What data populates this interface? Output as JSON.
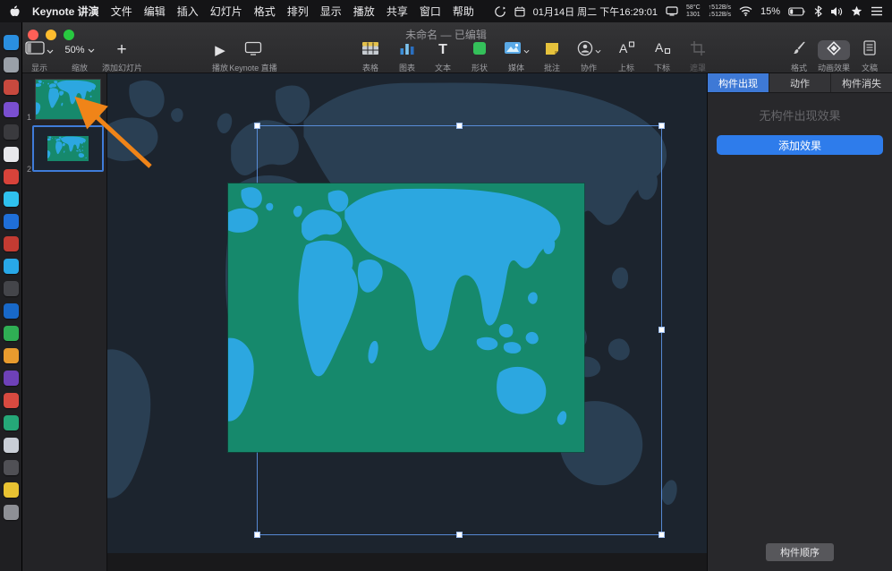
{
  "menu_bar": {
    "app_name": "Keynote 讲演",
    "menus": [
      "文件",
      "编辑",
      "插入",
      "幻灯片",
      "格式",
      "排列",
      "显示",
      "播放",
      "共享",
      "窗口",
      "帮助"
    ],
    "status": {
      "date_time": "01月14日 周二 下午16:29:01",
      "temp": "58°C",
      "temp_fan": "1301",
      "net_up": "↑512B/s",
      "net_down": "↓512B/s",
      "battery_pct": "15%"
    }
  },
  "window": {
    "title": "未命名 — 已编辑"
  },
  "toolbar": {
    "view": {
      "label": "显示"
    },
    "zoom": {
      "label": "缩放",
      "value": "50%"
    },
    "add_slide": {
      "label": "添加幻灯片"
    },
    "play": {
      "label": "播放"
    },
    "live": {
      "label": "Keynote 直播"
    },
    "insert_items": [
      {
        "label": "表格"
      },
      {
        "label": "图表"
      },
      {
        "label": "文本"
      },
      {
        "label": "形状"
      },
      {
        "label": "媒体"
      },
      {
        "label": "批注"
      },
      {
        "label": "协作"
      },
      {
        "label": "上标"
      },
      {
        "label": "下标"
      },
      {
        "label": "遮罩"
      }
    ],
    "right_items": [
      {
        "label": "格式"
      },
      {
        "label": "动画效果"
      },
      {
        "label": "文稿"
      }
    ]
  },
  "navigator": {
    "slides": [
      {
        "number": "1",
        "selected": false
      },
      {
        "number": "2",
        "selected": true
      }
    ]
  },
  "inspector": {
    "tabs": [
      {
        "label": "构件出现",
        "selected": true
      },
      {
        "label": "动作",
        "selected": false
      },
      {
        "label": "构件消失",
        "selected": false
      }
    ],
    "empty_text": "无构件出现效果",
    "add_effect_button": "添加效果",
    "build_order_button": "构件顺序"
  },
  "colors": {
    "accent_blue": "#2e7ceb",
    "selection_blue": "#3f7cd9",
    "arrow_orange": "#f08418",
    "map_dark_ocean": "#1c242e",
    "map_dark_land": "#2a3f53",
    "map_green_bg": "#16896c",
    "map_green_land": "#2ca7e0"
  },
  "dock": {
    "items": [
      "#2a8fe0",
      "#9aa0a8",
      "#c8493e",
      "#7a4fd0",
      "#3a3a3e",
      "#e8e8ec",
      "#d8433a",
      "#2fc1ee",
      "#1f6fd8",
      "#c33b32",
      "#28a8e8",
      "#44454a",
      "#1868c8",
      "#2fae54",
      "#e89b2e",
      "#6e41b8",
      "#d84a40",
      "#25a878",
      "#c9ced6",
      "#505055",
      "#e8c232",
      "#8e9096"
    ]
  }
}
